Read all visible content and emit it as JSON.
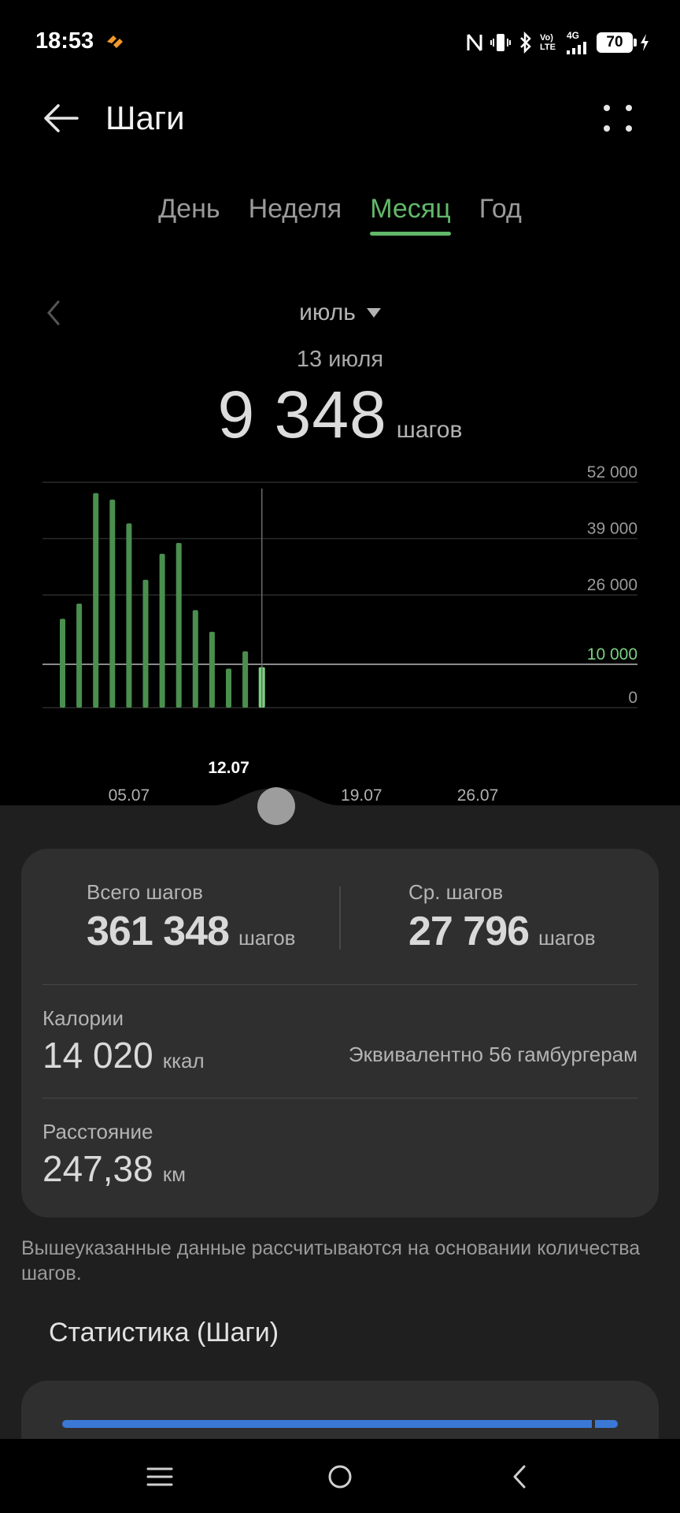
{
  "status_bar": {
    "time": "18:53",
    "signal_label_top": "Vo) LTE",
    "signal_label_gen": "4G",
    "battery_level": "70"
  },
  "header": {
    "title": "Шаги"
  },
  "tabs": [
    {
      "label": "День",
      "active": false
    },
    {
      "label": "Неделя",
      "active": false
    },
    {
      "label": "Месяц",
      "active": true
    },
    {
      "label": "Год",
      "active": false
    }
  ],
  "period": {
    "month_label": "июль",
    "selected_date": "13 июля",
    "selected_value": "9 348",
    "selected_unit": "шагов"
  },
  "chart_data": {
    "type": "bar",
    "x": [
      "01.07",
      "02.07",
      "03.07",
      "04.07",
      "05.07",
      "06.07",
      "07.07",
      "08.07",
      "09.07",
      "10.07",
      "11.07",
      "12.07",
      "13.07"
    ],
    "values": [
      20500,
      24000,
      49500,
      48000,
      42500,
      29500,
      35500,
      38000,
      22500,
      17500,
      9000,
      13000,
      9348
    ],
    "selected_index": 12,
    "ylim": [
      0,
      52000
    ],
    "y_ticks": [
      {
        "value": 52000,
        "label": "52 000"
      },
      {
        "value": 39000,
        "label": "39 000"
      },
      {
        "value": 26000,
        "label": "26 000"
      },
      {
        "value": 10000,
        "label": "10 000"
      },
      {
        "value": 0,
        "label": "0"
      }
    ],
    "goal_line": {
      "value": 10000,
      "label": "10 000"
    },
    "x_tick_labels": [
      {
        "day": 5,
        "label": "05.07"
      },
      {
        "day": 12,
        "label": "12.07"
      },
      {
        "day": 19,
        "label": "19.07"
      },
      {
        "day": 26,
        "label": "26.07"
      }
    ],
    "highlight_label": "12.07",
    "days_in_month": 31,
    "grid": true,
    "colors": {
      "bar": "#4a8f4e",
      "bar_selected": "#7bd080",
      "goal_line": "#8a8a8a",
      "grid": "#2a2a2a"
    }
  },
  "summary": {
    "total": {
      "label": "Всего шагов",
      "value": "361 348",
      "unit": "шагов"
    },
    "average": {
      "label": "Ср. шагов",
      "value": "27 796",
      "unit": "шагов"
    },
    "calories": {
      "label": "Калории",
      "value": "14 020",
      "unit": "ккал",
      "equivalent": "Эквивалентно 56 гамбургерам"
    },
    "distance": {
      "label": "Расстояние",
      "value": "247,38",
      "unit": "км"
    }
  },
  "disclaimer": "Вышеуказанные данные рассчитываются на основании количества шагов.",
  "statistics": {
    "title": "Статистика (Шаги)"
  },
  "colors": {
    "accent": "#62b86a",
    "progress": "#3b78d6"
  }
}
